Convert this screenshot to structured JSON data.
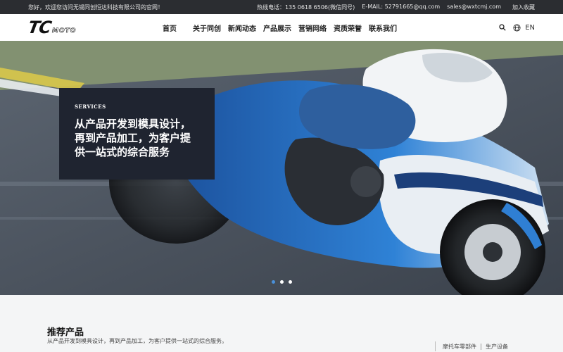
{
  "topbar": {
    "welcome": "您好，欢迎您访问无锡同创恒达科技有限公司的官网！",
    "hotline": "热线电话：135 0618 6506(微信同号)",
    "email1": "E-MAIL: 52791665@qq.com",
    "email2": "sales@wxtcmj.com",
    "favorite": "加入收藏"
  },
  "header": {
    "logo_main": "TC",
    "logo_sub": "MOTO",
    "nav": [
      "首页",
      "关于同创",
      "新闻动态",
      "产品展示",
      "营销网络",
      "资质荣誉",
      "联系我们"
    ],
    "lang": "EN",
    "icons": [
      "search-icon",
      "globe-icon"
    ]
  },
  "hero": {
    "eyebrow": "SERVICES",
    "headline": "从产品开发到模具设计，再到产品加工，为客户提供一站式的综合服务",
    "slides": 3,
    "active_slide": 1
  },
  "products": {
    "title": "推荐产品",
    "desc": "从产品开发到模具设计，再到产品加工，为客户提供一站式的综合服务。",
    "tabs": [
      "摩托车零部件",
      "生产设备"
    ]
  },
  "colors": {
    "topbar_bg": "#2b2d31",
    "card_bg": "#1f2430",
    "active_dot": "#4a90d9",
    "section_bg": "#f4f5f6"
  }
}
